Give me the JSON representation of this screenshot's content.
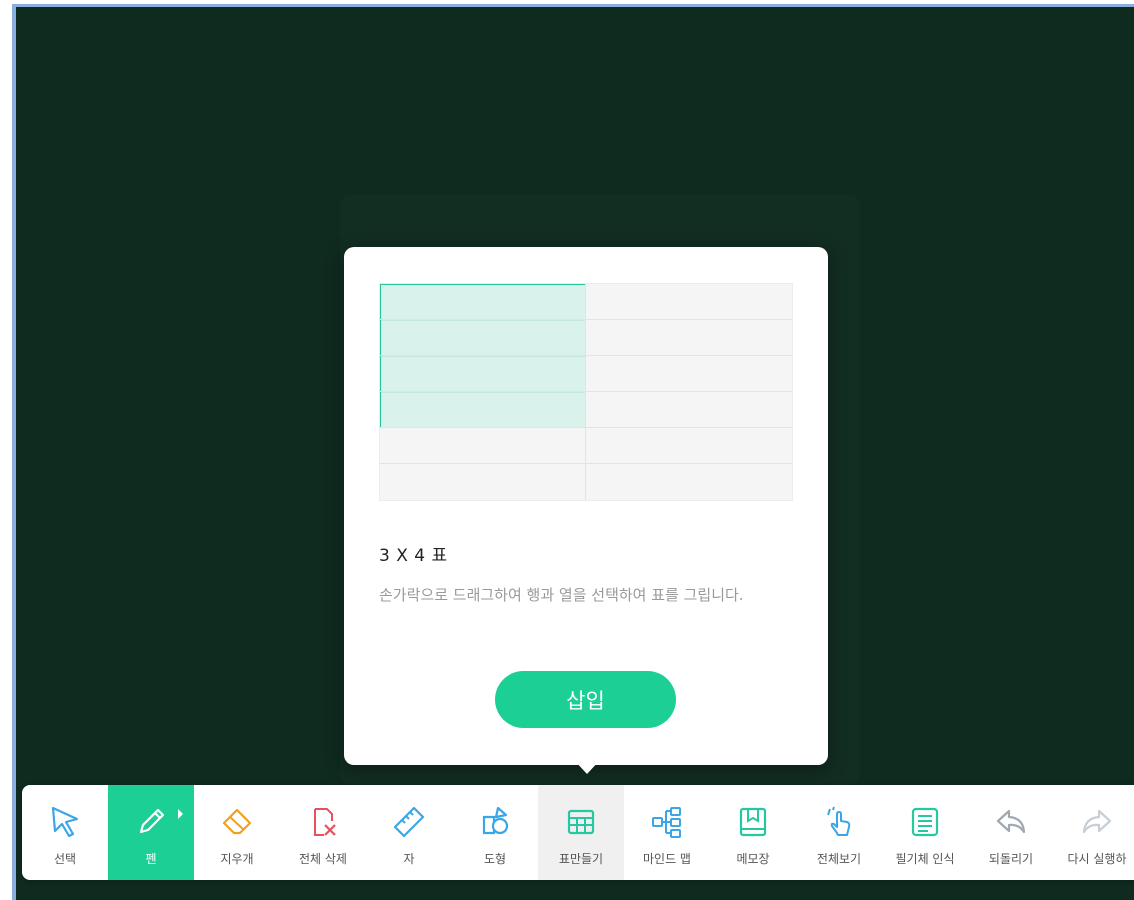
{
  "dialog": {
    "size_label": "3 X 4 표",
    "description": "손가락으로 드래그하여 행과 열을 선택하여 표를 그립니다.",
    "insert_label": "삽입",
    "table_grid": {
      "rows": 6,
      "cols": 2,
      "selected_rows": 4,
      "selected_cols": 1
    }
  },
  "toolbar": {
    "items": [
      {
        "label": "선택",
        "icon": "select-cursor-icon"
      },
      {
        "label": "펜",
        "icon": "pen-icon"
      },
      {
        "label": "지우개",
        "icon": "eraser-icon"
      },
      {
        "label": "전체 삭제",
        "icon": "clear-all-icon"
      },
      {
        "label": "자",
        "icon": "ruler-icon"
      },
      {
        "label": "도형",
        "icon": "shapes-icon"
      },
      {
        "label": "표만들기",
        "icon": "table-icon"
      },
      {
        "label": "마인드 맵",
        "icon": "mind-map-icon"
      },
      {
        "label": "메모장",
        "icon": "notepad-icon"
      },
      {
        "label": "전체보기",
        "icon": "view-all-icon"
      },
      {
        "label": "필기체 인식",
        "icon": "handwriting-icon"
      },
      {
        "label": "되돌리기",
        "icon": "undo-icon"
      },
      {
        "label": "다시 실행하",
        "icon": "redo-icon"
      }
    ]
  },
  "colors": {
    "board": "#0f2a1f",
    "accent": "#1ccf95",
    "icon_blue": "#3aa6e8",
    "icon_teal": "#25c8a0",
    "icon_orange": "#f0a020",
    "icon_red": "#e8505b",
    "icon_gray": "#a0a8b4"
  }
}
